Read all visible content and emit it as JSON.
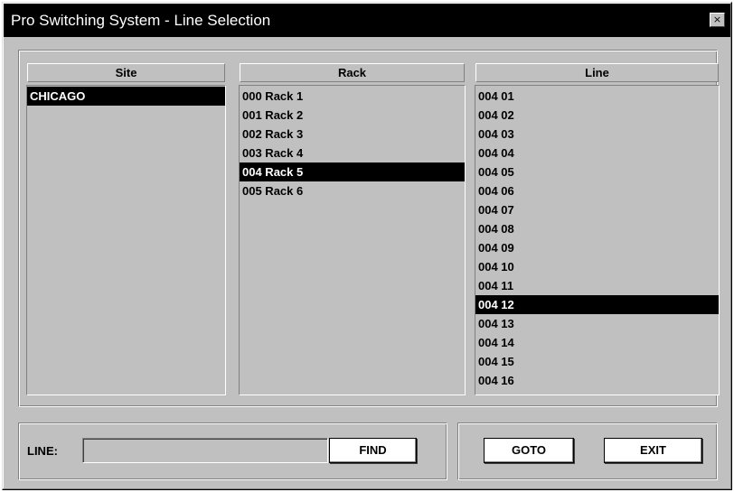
{
  "window": {
    "title": "Pro Switching System - Line Selection",
    "close_icon": "close-icon",
    "close_glyph": "×"
  },
  "columns": {
    "site": {
      "header": "Site",
      "items": [
        "CHICAGO"
      ],
      "selected": "CHICAGO"
    },
    "rack": {
      "header": "Rack",
      "items": [
        "000 Rack 1",
        "001 Rack 2",
        "002 Rack 3",
        "003 Rack 4",
        "004 Rack 5",
        "005 Rack 6"
      ],
      "selected": "004 Rack 5"
    },
    "line": {
      "header": "Line",
      "items": [
        "004 01",
        "004 02",
        "004 03",
        "004 04",
        "004 05",
        "004 06",
        "004 07",
        "004 08",
        "004 09",
        "004 10",
        "004 11",
        "004 12",
        "004 13",
        "004 14",
        "004 15",
        "004 16"
      ],
      "selected": "004 12"
    }
  },
  "bottom": {
    "line_label": "LINE:",
    "line_value": "",
    "find_label": "FIND",
    "goto_label": "GOTO",
    "exit_label": "EXIT"
  },
  "colors": {
    "face": "#c0c0c0",
    "titlebar": "#000000",
    "selection": "#000000",
    "selection_text": "#ffffff"
  }
}
